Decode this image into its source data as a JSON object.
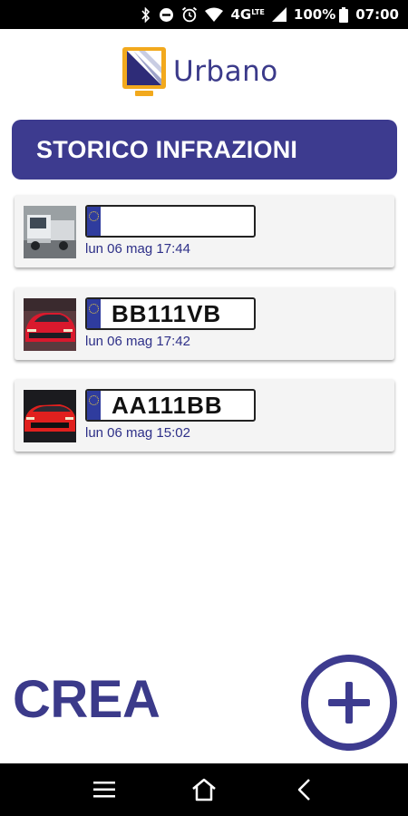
{
  "status_bar": {
    "battery_text": "100%",
    "network_text": "4G",
    "network_sup": "LTE",
    "time": "07:00"
  },
  "app": {
    "logo_text": "Urbano",
    "header_title": "STORICO INFRAZIONI"
  },
  "infractions": [
    {
      "plate": "",
      "date": "lun 06 mag 17:44",
      "thumb": "white-truck"
    },
    {
      "plate": "BB111VB",
      "date": "lun 06 mag 17:42",
      "thumb": "red-car"
    },
    {
      "plate": "AA111BB",
      "date": "lun 06 mag 15:02",
      "thumb": "red-car"
    }
  ],
  "actions": {
    "create_label": "CREA",
    "add_icon": "plus-icon"
  },
  "nav": {
    "menu_icon": "menu-icon",
    "home_icon": "home-icon",
    "back_icon": "back-icon"
  },
  "colors": {
    "brand": "#3d3b8f",
    "date_text": "#2e3088",
    "logo_accent": "#f2a91d"
  }
}
